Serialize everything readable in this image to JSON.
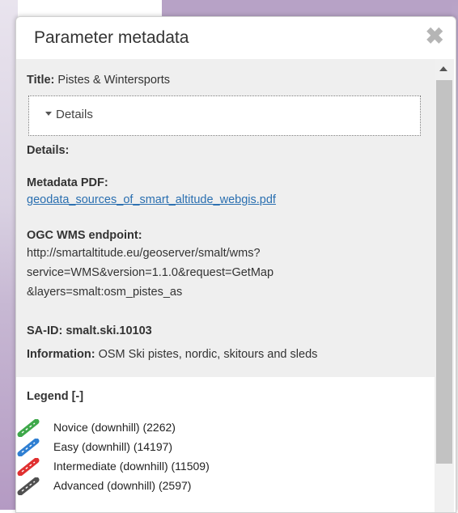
{
  "dialog": {
    "title": "Parameter metadata",
    "close_glyph": "✖"
  },
  "metadata": {
    "title_label": "Title:",
    "title_value": "Pistes & Wintersports",
    "details_toggle": "Details",
    "details_label": "Details:",
    "pdf_label": "Metadata PDF:",
    "pdf_link": "geodata_sources_of_smart_altitude_webgis.pdf",
    "wms_label": "OGC WMS endpoint:",
    "wms_lines": [
      "http://smartaltitude.eu/geoserver/smalt/wms?",
      "service=WMS&version=1.1.0&request=GetMap",
      "&layers=smalt:osm_pistes_as"
    ],
    "said": "SA-ID: smalt.ski.10103",
    "info_label": "Information:",
    "info_value": "OSM Ski pistes, nordic, skitours and sleds"
  },
  "legend": {
    "header": "Legend [-]",
    "items": [
      {
        "label": "Novice (downhill) (2262)",
        "color": "#3ea84a",
        "icon": "ski-piste-line-icon"
      },
      {
        "label": "Easy (downhill) (14197)",
        "color": "#2f7fd2",
        "icon": "ski-piste-line-icon"
      },
      {
        "label": "Intermediate (downhill) (11509)",
        "color": "#e03030",
        "icon": "ski-piste-line-icon"
      },
      {
        "label": "Advanced (downhill) (2597)",
        "color": "#505050",
        "icon": "ski-piste-line-icon"
      }
    ]
  }
}
